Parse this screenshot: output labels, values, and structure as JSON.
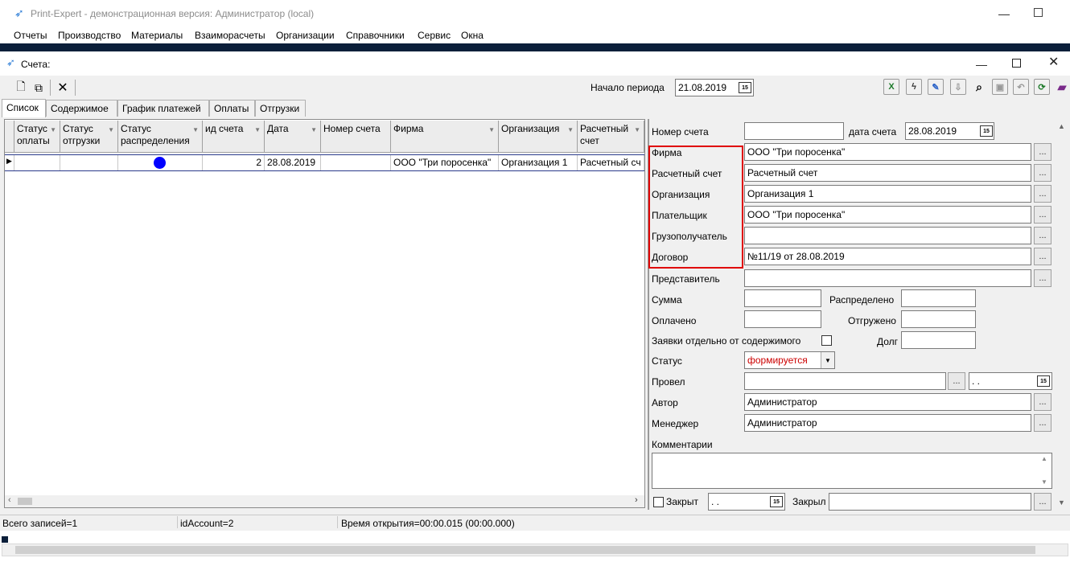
{
  "app": {
    "title": "Print-Expert - демонстрационная версия: Администратор (local)"
  },
  "menu": [
    "Отчеты",
    "Производство",
    "Материалы",
    "Взаиморасчеты",
    "Организации",
    "Справочники",
    "Сервис",
    "Окна"
  ],
  "window": {
    "title": "Счета:"
  },
  "toolbar": {
    "period_label": "Начало периода",
    "period_value": "21.08.2019"
  },
  "tabs": [
    "Список",
    "Содержимое",
    "График платежей",
    "Оплаты",
    "Отгрузки"
  ],
  "grid": {
    "headers": [
      "Статус оплаты",
      "Статус отгрузки",
      "Статус распределения",
      "ид счета",
      "Дата",
      "Номер счета",
      "Фирма",
      "Организация",
      "Расчетный счет"
    ],
    "row": {
      "id": "2",
      "date": "28.08.2019",
      "number": "",
      "firm": "ООО \"Три поросенка\"",
      "org": "Организация 1",
      "account": "Расчетный сч"
    },
    "status_dot_color": "#0000ff"
  },
  "form": {
    "number_label": "Номер счета",
    "number_value": "",
    "date_label": "дата счета",
    "date_value": "28.08.2019",
    "firm_label": "Фирма",
    "firm_value": "ООО \"Три поросенка\"",
    "account_label": "Расчетный счет",
    "account_value": "Расчетный счет",
    "org_label": "Организация",
    "org_value": "Организация 1",
    "payer_label": "Плательщик",
    "payer_value": "ООО \"Три поросенка\"",
    "consignee_label": "Грузополучатель",
    "consignee_value": "",
    "contract_label": "Договор",
    "contract_value": "№11/19 от 28.08.2019",
    "rep_label": "Представитель",
    "rep_value": "",
    "sum_label": "Сумма",
    "distributed_label": "Распределено",
    "paid_label": "Оплачено",
    "shipped_label": "Отгружено",
    "requests_label": "Заявки отдельно от содержимого",
    "debt_label": "Долг",
    "status_label": "Статус",
    "status_value": "формируется",
    "posted_label": "Провел",
    "posted_date": " .  .",
    "author_label": "Автор",
    "author_value": "Администратор",
    "manager_label": "Менеджер",
    "manager_value": "Администратор",
    "comments_label": "Комментарии",
    "closed_label": "Закрыт",
    "closed_date": " .  .",
    "closed_by_label": "Закрыл",
    "dots": "..."
  },
  "status": {
    "total": "Всего записей=1",
    "id": "idAccount=2",
    "time": "Время открытия=00:00.015 (00:00.000)"
  },
  "colors": {
    "highlight": "#e00000",
    "status_text": "#cc0000",
    "excel": "#1d7a2a"
  }
}
